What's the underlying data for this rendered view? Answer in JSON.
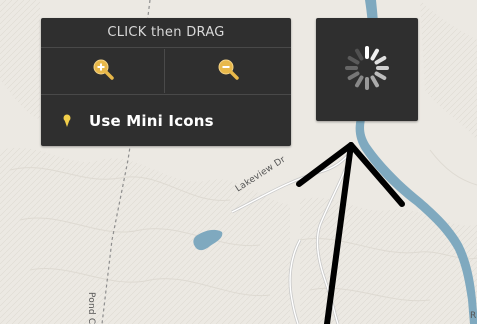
{
  "map": {
    "road_labels": {
      "lakeview": "Lakeview Dr",
      "pond": "Pond Cre",
      "edge": "R"
    }
  },
  "controls": {
    "title": "CLICK then DRAG",
    "zoom_in_icon": "zoom-in-magnifier-icon",
    "zoom_out_icon": "zoom-out-magnifier-icon",
    "mini_icons_label": "Use Mini Icons",
    "mini_icons_icon": "map-pin-icon"
  },
  "loader": {
    "icon": "loading-spinner-icon"
  },
  "colors": {
    "panel_bg": "#2f2f2f",
    "water": "#7fa9bf",
    "land": "#ece9e3",
    "icon_gold": "#e8b84a"
  }
}
